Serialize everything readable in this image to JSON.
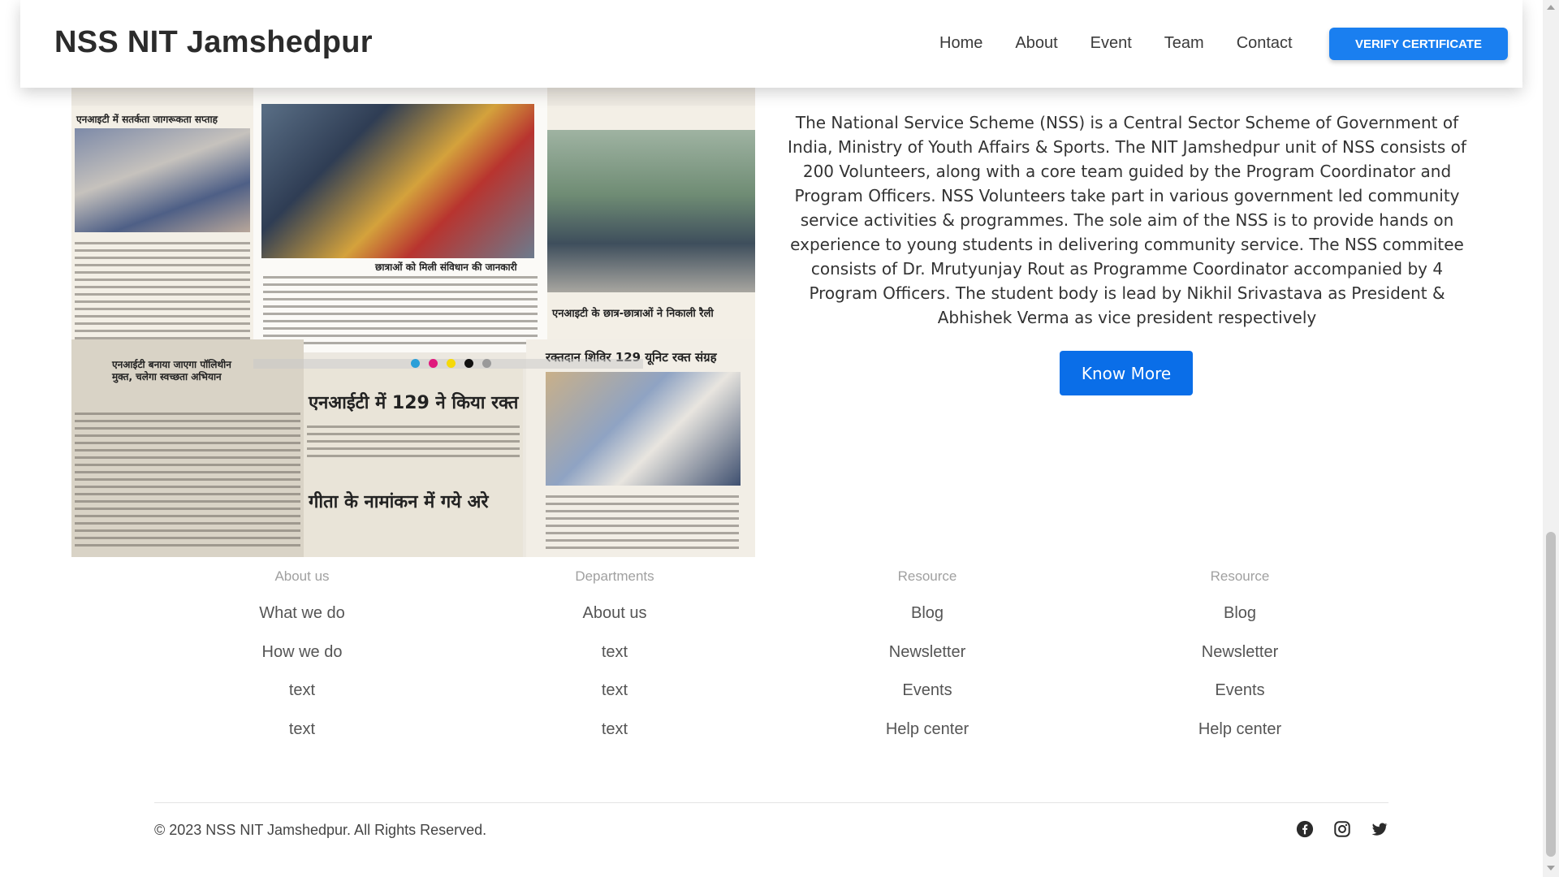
{
  "navbar": {
    "brand": "NSS NIT Jamshedpur",
    "links": [
      "Home",
      "About",
      "Event",
      "Team",
      "Contact"
    ],
    "verify_label": "VERIFY CERTIFICATE"
  },
  "collage": {
    "headlines": [
      "एनआइटी में सतर्कता जागरूकता सप्ताह",
      "छात्राओं को मिली संविधान की जानकारी",
      "एनआइटी के छात्र-छात्राओं ने निकाली रैली",
      "एनआईटी में 129 ने किया रक्त",
      "गीता के नामांकन में गये अरे",
      "रक्तदान शिविर 129 यूनिट रक्त संग्रह",
      "एनआईटी बनाया जाएगा पॉलिथीन मुक्त, चलेगा स्वच्छता अभियान"
    ],
    "dot_colors": [
      "#2a9fd8",
      "#e0197d",
      "#f5d90a",
      "#111111",
      "#9a9a9a"
    ]
  },
  "about": {
    "text": "The National Service Scheme (NSS) is a Central Sector Scheme of Government of India, Ministry of Youth Affairs & Sports. The NIT Jamshedpur unit of NSS consists of 200 Volunteers, along with a core team guided by the Program Coordinator and Program Officers. NSS Volunteers take part in various government led community service activities & programmes. The sole aim of the NSS is to provide hands on experience to young students in delivering community service. The NSS commitee consists of Dr. Mrutyunjay Rout as Programme Coordinator accompanied by 4 Program Officers. The student body is lead by Nikhil Srivastava as President & Abhishek Verma as vice president respectively",
    "button_label": "Know More"
  },
  "footer": {
    "columns": [
      {
        "heading": "About us",
        "items": [
          "What we do",
          "How we do",
          "text",
          "text"
        ]
      },
      {
        "heading": "Departments",
        "items": [
          "About us",
          "text",
          "text",
          "text"
        ]
      },
      {
        "heading": "Resource",
        "items": [
          "Blog",
          "Newsletter",
          "Events",
          "Help center"
        ]
      },
      {
        "heading": "Resource",
        "items": [
          "Blog",
          "Newsletter",
          "Events",
          "Help center"
        ]
      }
    ],
    "copyright": "© 2023 NSS NIT Jamshedpur. All Rights Reserved.",
    "socials": [
      "facebook-icon",
      "instagram-icon",
      "twitter-icon"
    ]
  },
  "colors": {
    "accent": "#1a7ff0",
    "know_more": "#0a6ee8"
  }
}
